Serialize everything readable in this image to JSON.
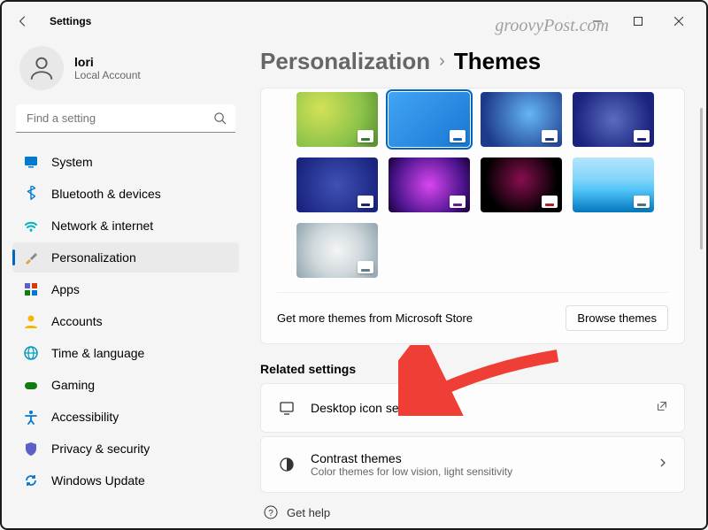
{
  "app_title": "Settings",
  "watermark": "groovyPost.com",
  "profile": {
    "name": "lori",
    "sub": "Local Account"
  },
  "search": {
    "placeholder": "Find a setting"
  },
  "nav": [
    {
      "id": "system",
      "label": "System",
      "icon": "display",
      "color": "#0078d4"
    },
    {
      "id": "bluetooth",
      "label": "Bluetooth & devices",
      "icon": "bluetooth",
      "color": "#0078d4"
    },
    {
      "id": "network",
      "label": "Network & internet",
      "icon": "wifi",
      "color": "#00b7c3"
    },
    {
      "id": "personalization",
      "label": "Personalization",
      "icon": "brush",
      "color": "#e8a33d",
      "active": true
    },
    {
      "id": "apps",
      "label": "Apps",
      "icon": "grid",
      "color": "#5b5fc7"
    },
    {
      "id": "accounts",
      "label": "Accounts",
      "icon": "person",
      "color": "#f7b500"
    },
    {
      "id": "time",
      "label": "Time & language",
      "icon": "globe",
      "color": "#0099bc"
    },
    {
      "id": "gaming",
      "label": "Gaming",
      "icon": "gamepad",
      "color": "#107c10"
    },
    {
      "id": "accessibility",
      "label": "Accessibility",
      "icon": "accessibility",
      "color": "#0078d4"
    },
    {
      "id": "privacy",
      "label": "Privacy & security",
      "icon": "shield",
      "color": "#5b5fc7"
    },
    {
      "id": "update",
      "label": "Windows Update",
      "icon": "sync",
      "color": "#0078d4"
    }
  ],
  "breadcrumb": {
    "parent": "Personalization",
    "current": "Themes"
  },
  "themes": [
    {
      "bg": "radial-gradient(circle at 30% 30%, #d4e157 0%, #8bc34a 60%, #558b2f 100%)",
      "swatch": "#2e7d32"
    },
    {
      "bg": "linear-gradient(135deg, #42a5f5 0%, #1976d2 100%)",
      "swatch": "#1565c0",
      "selected": true
    },
    {
      "bg": "radial-gradient(circle at 60% 40%, #64b5f6 0%, #1e3a8a 80%)",
      "swatch": "#1e3a8a"
    },
    {
      "bg": "radial-gradient(circle at 50% 50%, #5c6bc0 0%, #1a237e 80%)",
      "swatch": "#1a237e"
    },
    {
      "bg": "radial-gradient(circle at 50% 50%, #3f51b5 0%, #1a237e 90%)",
      "swatch": "#1a237e"
    },
    {
      "bg": "radial-gradient(circle at 50% 50%, #d946ef 0%, #4a148c 70%, #1a0033 100%)",
      "swatch": "#6a1b9a"
    },
    {
      "bg": "radial-gradient(circle at 50% 40%, #880e4f 0%, #000 70%)",
      "swatch": "#b71c1c"
    },
    {
      "bg": "linear-gradient(180deg, #b3e5fc 0%, #81d4fa 40%, #4fc3f7 60%, #0277bd 100%)",
      "swatch": "#546e7a"
    },
    {
      "bg": "radial-gradient(circle at 50% 50%, #f5f5f5 0%, #cfd8dc 50%, #90a4ae 100%)",
      "swatch": "#607d8b"
    }
  ],
  "store": {
    "text": "Get more themes from Microsoft Store",
    "button": "Browse themes"
  },
  "related": {
    "title": "Related settings",
    "items": [
      {
        "id": "desktop-icons",
        "title": "Desktop icon settings",
        "sub": "",
        "icon": "monitor",
        "action": "external"
      },
      {
        "id": "contrast",
        "title": "Contrast themes",
        "sub": "Color themes for low vision, light sensitivity",
        "icon": "contrast",
        "action": "chevron"
      }
    ]
  },
  "get_help": "Get help"
}
